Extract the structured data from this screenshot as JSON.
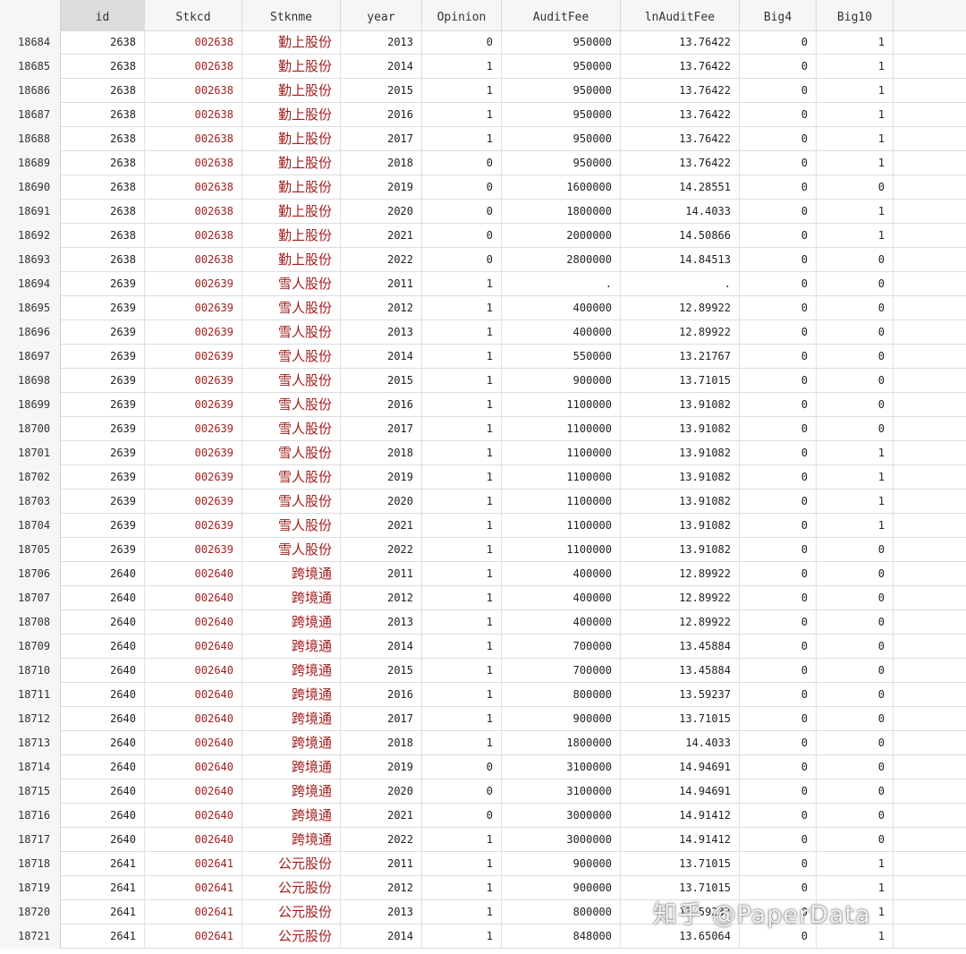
{
  "columns": [
    "",
    "id",
    "Stkcd",
    "Stknme",
    "year",
    "Opinion",
    "AuditFee",
    "lnAuditFee",
    "Big4",
    "Big10"
  ],
  "rows": [
    [
      "18684",
      "2638",
      "002638",
      "勤上股份",
      "2013",
      "0",
      "950000",
      "13.76422",
      "0",
      "1"
    ],
    [
      "18685",
      "2638",
      "002638",
      "勤上股份",
      "2014",
      "1",
      "950000",
      "13.76422",
      "0",
      "1"
    ],
    [
      "18686",
      "2638",
      "002638",
      "勤上股份",
      "2015",
      "1",
      "950000",
      "13.76422",
      "0",
      "1"
    ],
    [
      "18687",
      "2638",
      "002638",
      "勤上股份",
      "2016",
      "1",
      "950000",
      "13.76422",
      "0",
      "1"
    ],
    [
      "18688",
      "2638",
      "002638",
      "勤上股份",
      "2017",
      "1",
      "950000",
      "13.76422",
      "0",
      "1"
    ],
    [
      "18689",
      "2638",
      "002638",
      "勤上股份",
      "2018",
      "0",
      "950000",
      "13.76422",
      "0",
      "1"
    ],
    [
      "18690",
      "2638",
      "002638",
      "勤上股份",
      "2019",
      "0",
      "1600000",
      "14.28551",
      "0",
      "0"
    ],
    [
      "18691",
      "2638",
      "002638",
      "勤上股份",
      "2020",
      "0",
      "1800000",
      "14.4033",
      "0",
      "1"
    ],
    [
      "18692",
      "2638",
      "002638",
      "勤上股份",
      "2021",
      "0",
      "2000000",
      "14.50866",
      "0",
      "1"
    ],
    [
      "18693",
      "2638",
      "002638",
      "勤上股份",
      "2022",
      "0",
      "2800000",
      "14.84513",
      "0",
      "0"
    ],
    [
      "18694",
      "2639",
      "002639",
      "雪人股份",
      "2011",
      "1",
      ".",
      ".",
      "0",
      "0"
    ],
    [
      "18695",
      "2639",
      "002639",
      "雪人股份",
      "2012",
      "1",
      "400000",
      "12.89922",
      "0",
      "0"
    ],
    [
      "18696",
      "2639",
      "002639",
      "雪人股份",
      "2013",
      "1",
      "400000",
      "12.89922",
      "0",
      "0"
    ],
    [
      "18697",
      "2639",
      "002639",
      "雪人股份",
      "2014",
      "1",
      "550000",
      "13.21767",
      "0",
      "0"
    ],
    [
      "18698",
      "2639",
      "002639",
      "雪人股份",
      "2015",
      "1",
      "900000",
      "13.71015",
      "0",
      "0"
    ],
    [
      "18699",
      "2639",
      "002639",
      "雪人股份",
      "2016",
      "1",
      "1100000",
      "13.91082",
      "0",
      "0"
    ],
    [
      "18700",
      "2639",
      "002639",
      "雪人股份",
      "2017",
      "1",
      "1100000",
      "13.91082",
      "0",
      "0"
    ],
    [
      "18701",
      "2639",
      "002639",
      "雪人股份",
      "2018",
      "1",
      "1100000",
      "13.91082",
      "0",
      "1"
    ],
    [
      "18702",
      "2639",
      "002639",
      "雪人股份",
      "2019",
      "1",
      "1100000",
      "13.91082",
      "0",
      "1"
    ],
    [
      "18703",
      "2639",
      "002639",
      "雪人股份",
      "2020",
      "1",
      "1100000",
      "13.91082",
      "0",
      "1"
    ],
    [
      "18704",
      "2639",
      "002639",
      "雪人股份",
      "2021",
      "1",
      "1100000",
      "13.91082",
      "0",
      "1"
    ],
    [
      "18705",
      "2639",
      "002639",
      "雪人股份",
      "2022",
      "1",
      "1100000",
      "13.91082",
      "0",
      "0"
    ],
    [
      "18706",
      "2640",
      "002640",
      "跨境通",
      "2011",
      "1",
      "400000",
      "12.89922",
      "0",
      "0"
    ],
    [
      "18707",
      "2640",
      "002640",
      "跨境通",
      "2012",
      "1",
      "400000",
      "12.89922",
      "0",
      "0"
    ],
    [
      "18708",
      "2640",
      "002640",
      "跨境通",
      "2013",
      "1",
      "400000",
      "12.89922",
      "0",
      "0"
    ],
    [
      "18709",
      "2640",
      "002640",
      "跨境通",
      "2014",
      "1",
      "700000",
      "13.45884",
      "0",
      "0"
    ],
    [
      "18710",
      "2640",
      "002640",
      "跨境通",
      "2015",
      "1",
      "700000",
      "13.45884",
      "0",
      "0"
    ],
    [
      "18711",
      "2640",
      "002640",
      "跨境通",
      "2016",
      "1",
      "800000",
      "13.59237",
      "0",
      "0"
    ],
    [
      "18712",
      "2640",
      "002640",
      "跨境通",
      "2017",
      "1",
      "900000",
      "13.71015",
      "0",
      "0"
    ],
    [
      "18713",
      "2640",
      "002640",
      "跨境通",
      "2018",
      "1",
      "1800000",
      "14.4033",
      "0",
      "0"
    ],
    [
      "18714",
      "2640",
      "002640",
      "跨境通",
      "2019",
      "0",
      "3100000",
      "14.94691",
      "0",
      "0"
    ],
    [
      "18715",
      "2640",
      "002640",
      "跨境通",
      "2020",
      "0",
      "3100000",
      "14.94691",
      "0",
      "0"
    ],
    [
      "18716",
      "2640",
      "002640",
      "跨境通",
      "2021",
      "0",
      "3000000",
      "14.91412",
      "0",
      "0"
    ],
    [
      "18717",
      "2640",
      "002640",
      "跨境通",
      "2022",
      "1",
      "3000000",
      "14.91412",
      "0",
      "0"
    ],
    [
      "18718",
      "2641",
      "002641",
      "公元股份",
      "2011",
      "1",
      "900000",
      "13.71015",
      "0",
      "1"
    ],
    [
      "18719",
      "2641",
      "002641",
      "公元股份",
      "2012",
      "1",
      "900000",
      "13.71015",
      "0",
      "1"
    ],
    [
      "18720",
      "2641",
      "002641",
      "公元股份",
      "2013",
      "1",
      "800000",
      "13.59237",
      "0",
      "1"
    ],
    [
      "18721",
      "2641",
      "002641",
      "公元股份",
      "2014",
      "1",
      "848000",
      "13.65064",
      "0",
      "1"
    ]
  ],
  "watermark": "知乎 @PaperData",
  "colors": {
    "code_text": "#a11f1f",
    "header_bg": "#f6f6f6",
    "selected_header_bg": "#dcdcdc"
  }
}
